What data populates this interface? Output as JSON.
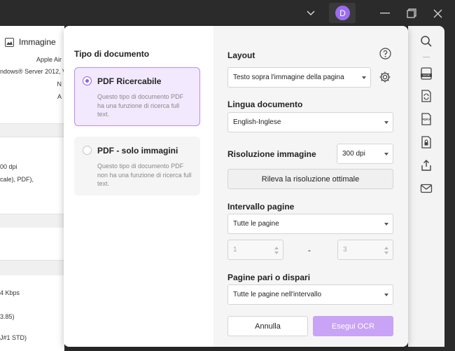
{
  "titlebar": {
    "avatar_letter": "D",
    "icons": [
      "chevron-down-icon",
      "minimize-icon",
      "restore-icon",
      "close-icon"
    ]
  },
  "background_doc": {
    "header_label": "Immagine",
    "lines": [
      "Apple Air",
      "ndows® Server 2012, V",
      "N",
      "A",
      "00 dpi",
      "cale), PDF),",
      "4 Kbps",
      "3.85)",
      "J#1 STD)"
    ]
  },
  "dialog": {
    "left": {
      "title": "Tipo di documento",
      "options": [
        {
          "label": "PDF Ricercabile",
          "description": "Questo tipo di documento PDF ha una funzione di ricerca full text.",
          "selected": true
        },
        {
          "label": "PDF - solo immagini",
          "description": "Questo tipo di documento PDF non ha una funzione di ricerca full text.",
          "selected": false
        }
      ]
    },
    "right": {
      "layout_label": "Layout",
      "layout_value": "Testo sopra l'immagine della pagina",
      "language_label": "Lingua documento",
      "language_value": "English-Inglese",
      "resolution_label": "Risoluzione immagine",
      "resolution_value": "300 dpi",
      "detect_button": "Rileva la risoluzione ottimale",
      "page_range_label": "Intervallo pagine",
      "page_range_value": "Tutte le pagine",
      "page_from": "1",
      "page_to": "3",
      "range_separator": "-",
      "odd_even_label": "Pagine pari o dispari",
      "odd_even_value": "Tutte le pagine nell'intervallo",
      "cancel_button": "Annulla",
      "run_button": "Esegui OCR"
    }
  },
  "right_toolbar": {
    "icons": [
      "search-icon",
      "ocr-icon",
      "convert-icon",
      "pdfa-icon",
      "protect-icon",
      "share-icon",
      "mail-icon"
    ]
  },
  "colors": {
    "accent": "#8e5ff0",
    "selected_card_bg": "#f3e9ff",
    "primary_button": "#c9a3f5",
    "titlebar_bg": "#2b2b2b"
  }
}
